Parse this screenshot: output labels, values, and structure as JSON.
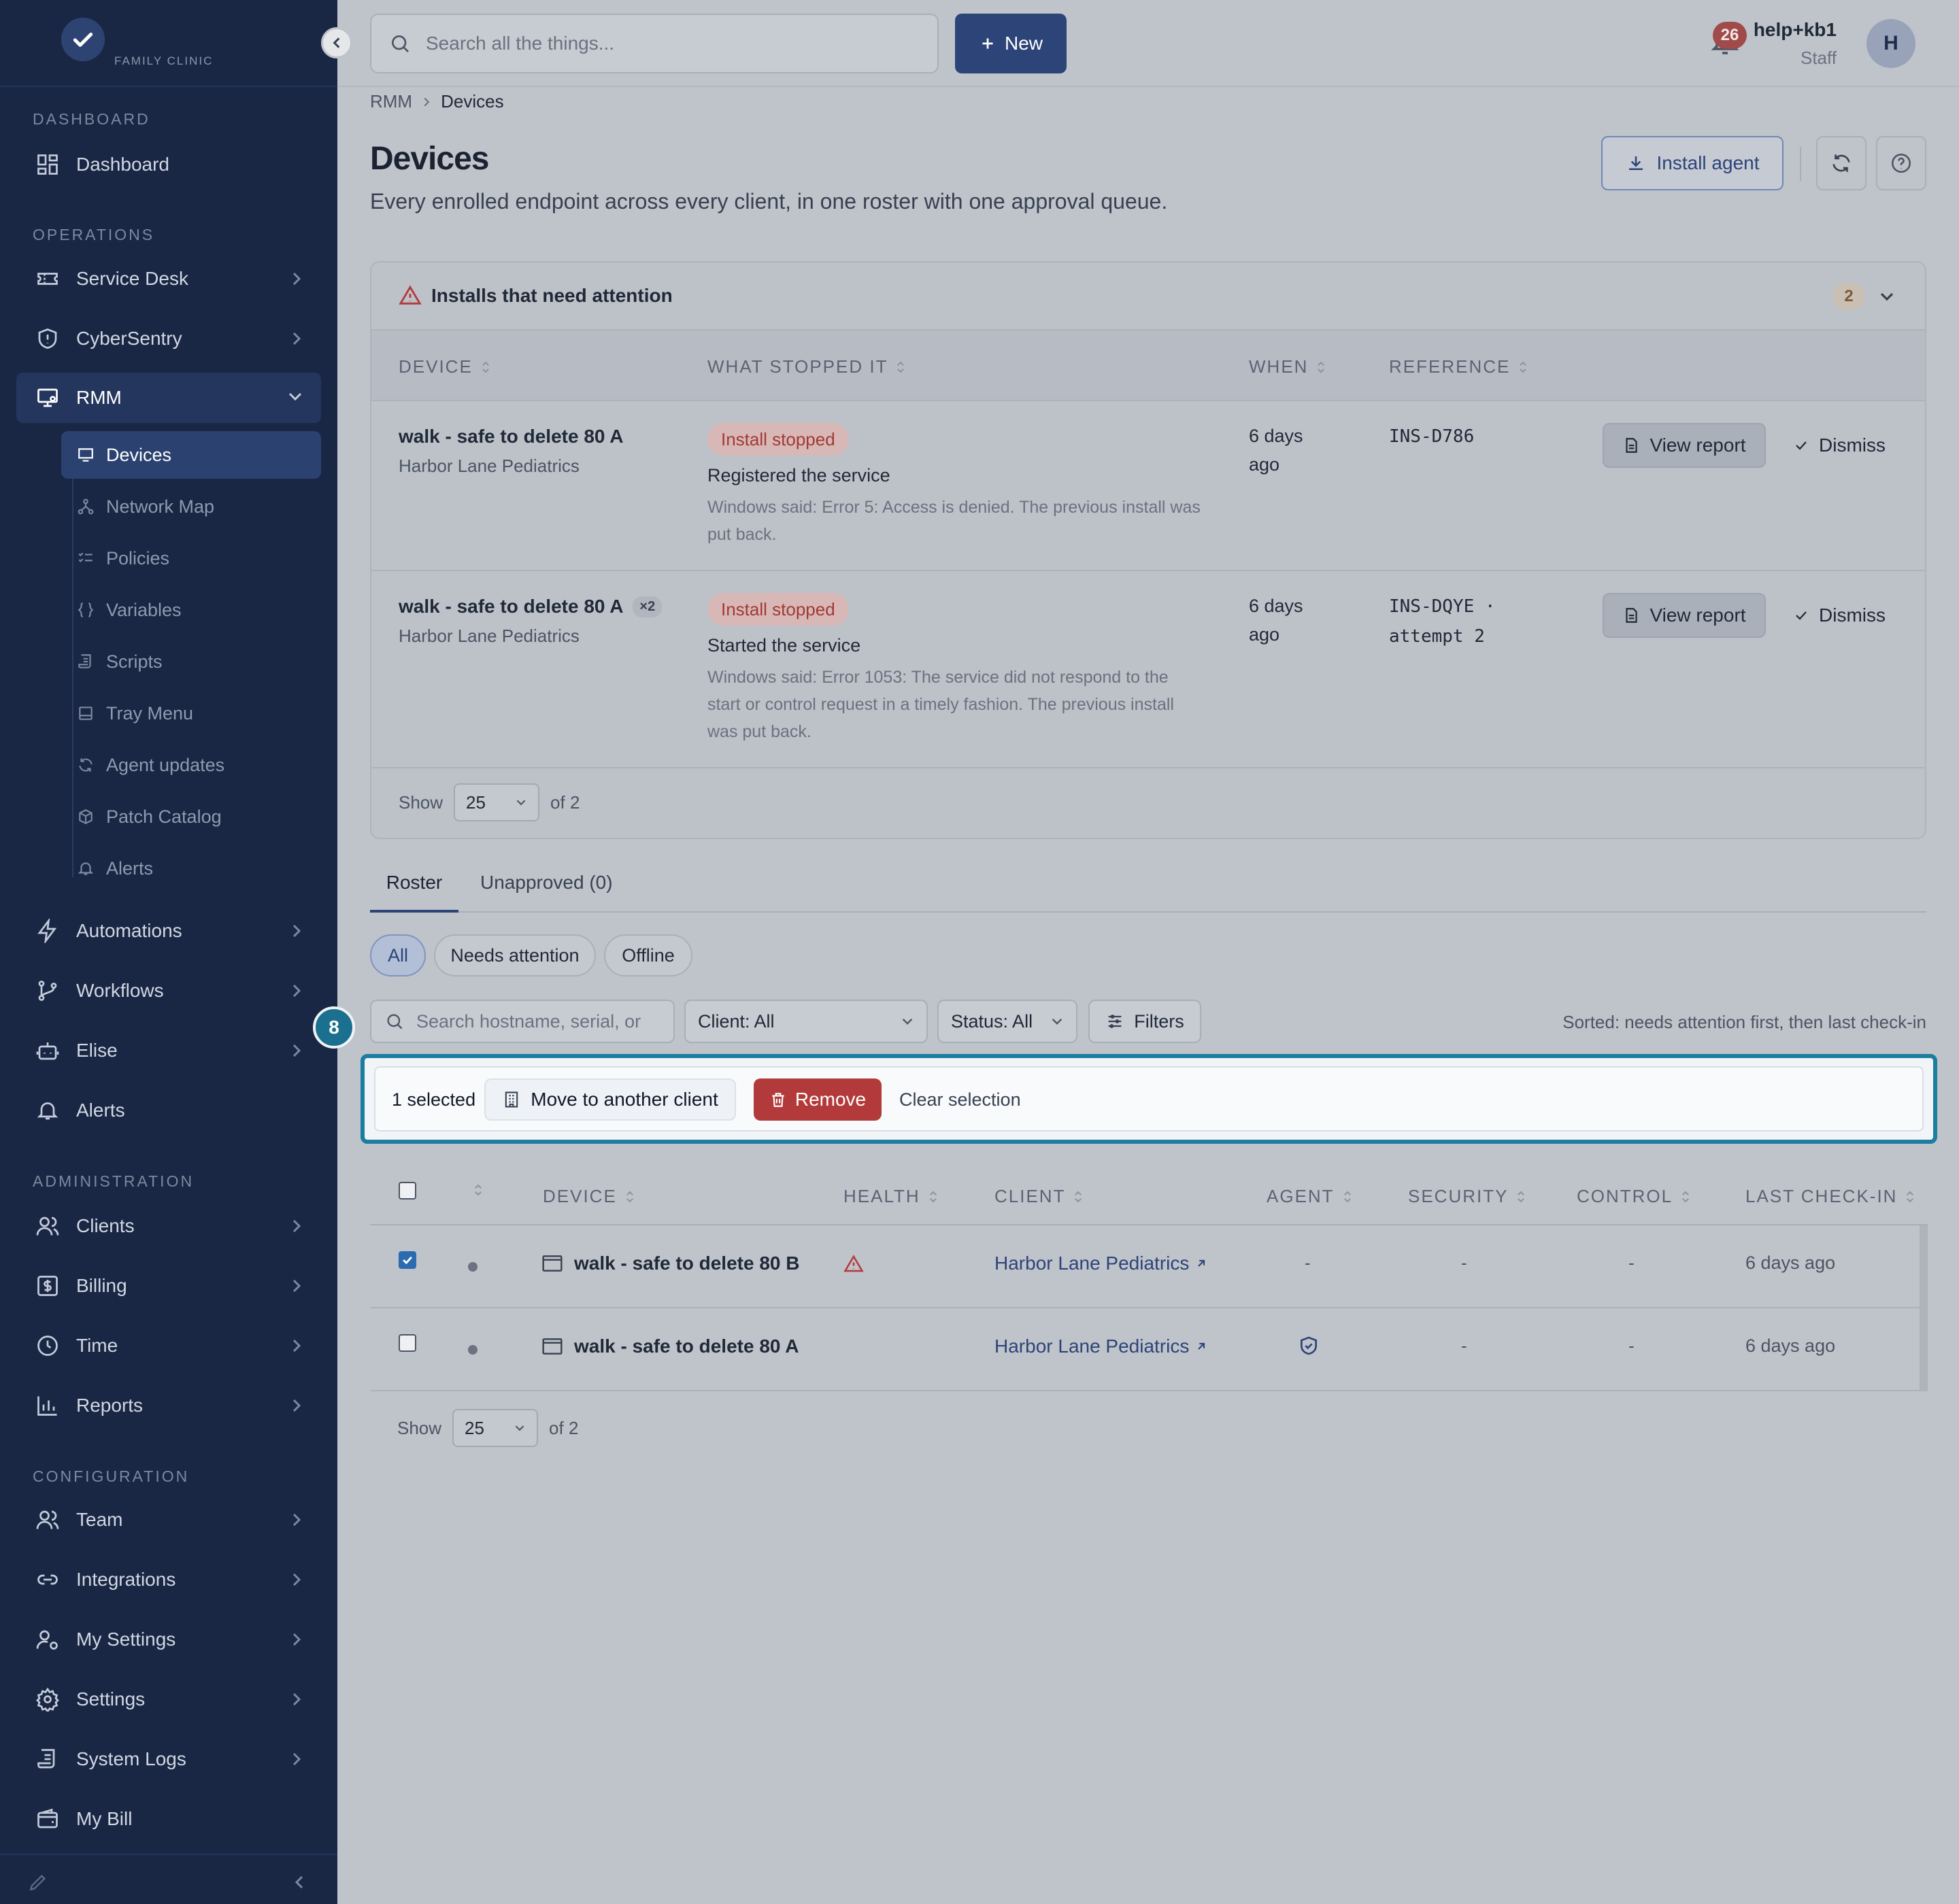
{
  "brand": {
    "logo_text": "FAMILY CLINIC"
  },
  "sidebar": {
    "sections": {
      "dashboard": "DASHBOARD",
      "operations": "OPERATIONS",
      "administration": "ADMINISTRATION",
      "configuration": "CONFIGURATION"
    },
    "items": {
      "dashboard": "Dashboard",
      "service_desk": "Service Desk",
      "cybersentry": "CyberSentry",
      "rmm": "RMM",
      "automations": "Automations",
      "workflows": "Workflows",
      "elise": "Elise",
      "alerts": "Alerts",
      "clients": "Clients",
      "billing": "Billing",
      "time": "Time",
      "reports": "Reports",
      "team": "Team",
      "integrations": "Integrations",
      "my_settings": "My Settings",
      "settings": "Settings",
      "system_logs": "System Logs",
      "my_bill": "My Bill"
    },
    "rmm_sub": {
      "devices": "Devices",
      "network_map": "Network Map",
      "policies": "Policies",
      "variables": "Variables",
      "scripts": "Scripts",
      "tray_menu": "Tray Menu",
      "agent_updates": "Agent updates",
      "patch_catalog": "Patch Catalog",
      "alerts": "Alerts"
    }
  },
  "topbar": {
    "search_placeholder": "Search all the things...",
    "new_label": "New",
    "notification_count": "26",
    "user_name": "help+kb1",
    "user_role": "Staff",
    "avatar_initial": "H"
  },
  "breadcrumb": {
    "parent": "RMM",
    "current": "Devices"
  },
  "page": {
    "title": "Devices",
    "subtitle": "Every enrolled endpoint across every client, in one roster with one approval queue.",
    "install_agent_label": "Install agent"
  },
  "installs_panel": {
    "title": "Installs that need attention",
    "count": "2",
    "columns": {
      "device": "DEVICE",
      "what_stopped": "WHAT STOPPED IT",
      "when": "WHEN",
      "reference": "REFERENCE"
    },
    "rows": [
      {
        "device": "walk - safe to delete 80 A",
        "client": "Harbor Lane Pediatrics",
        "badge": "Install stopped",
        "step": "Registered the service",
        "message": "Windows said: Error 5: Access is denied. The previous install was put back.",
        "when": "6 days ago",
        "reference": "INS-D786",
        "view_report": "View report",
        "dismiss": "Dismiss"
      },
      {
        "device": "walk - safe to delete 80 A",
        "multiplier": "×2",
        "client": "Harbor Lane Pediatrics",
        "badge": "Install stopped",
        "step": "Started the service",
        "message": "Windows said: Error 1053: The service did not respond to the start or control request in a timely fashion. The previous install was put back.",
        "when": "6 days ago",
        "reference": "INS-DQYE · attempt 2",
        "view_report": "View report",
        "dismiss": "Dismiss"
      }
    ],
    "pager": {
      "show": "Show",
      "size": "25",
      "of": "of 2"
    }
  },
  "tabs": {
    "roster": "Roster",
    "unapproved": "Unapproved (0)"
  },
  "chips": {
    "all": "All",
    "needs_attention": "Needs attention",
    "offline": "Offline"
  },
  "filters": {
    "search_placeholder": "Search hostname, serial, or",
    "client": "Client: All",
    "status": "Status: All",
    "filters_label": "Filters",
    "sorted_note": "Sorted: needs attention first, then last check-in"
  },
  "tour_step": "8",
  "selection_bar": {
    "count": "1 selected",
    "move": "Move to another client",
    "remove": "Remove",
    "clear": "Clear selection"
  },
  "roster": {
    "columns": {
      "device": "DEVICE",
      "health": "HEALTH",
      "client": "CLIENT",
      "agent": "AGENT",
      "security": "SECURITY",
      "control": "CONTROL",
      "last_checkin": "LAST CHECK-IN"
    },
    "rows": [
      {
        "selected": true,
        "device": "walk - safe to delete 80 B",
        "health": "warning",
        "client": "Harbor Lane Pediatrics",
        "agent": "-",
        "security": "-",
        "control": "-",
        "last_checkin": "6 days ago"
      },
      {
        "selected": false,
        "device": "walk - safe to delete 80 A",
        "health": "",
        "client": "Harbor Lane Pediatrics",
        "agent": "shield",
        "security": "-",
        "control": "-",
        "last_checkin": "6 days ago"
      }
    ],
    "pager": {
      "show": "Show",
      "size": "25",
      "of": "of 2"
    }
  },
  "colors": {
    "sidebar": "#1a2744",
    "primary": "#2d4478",
    "danger": "#b33a3a",
    "highlight": "#1b7d9f"
  }
}
